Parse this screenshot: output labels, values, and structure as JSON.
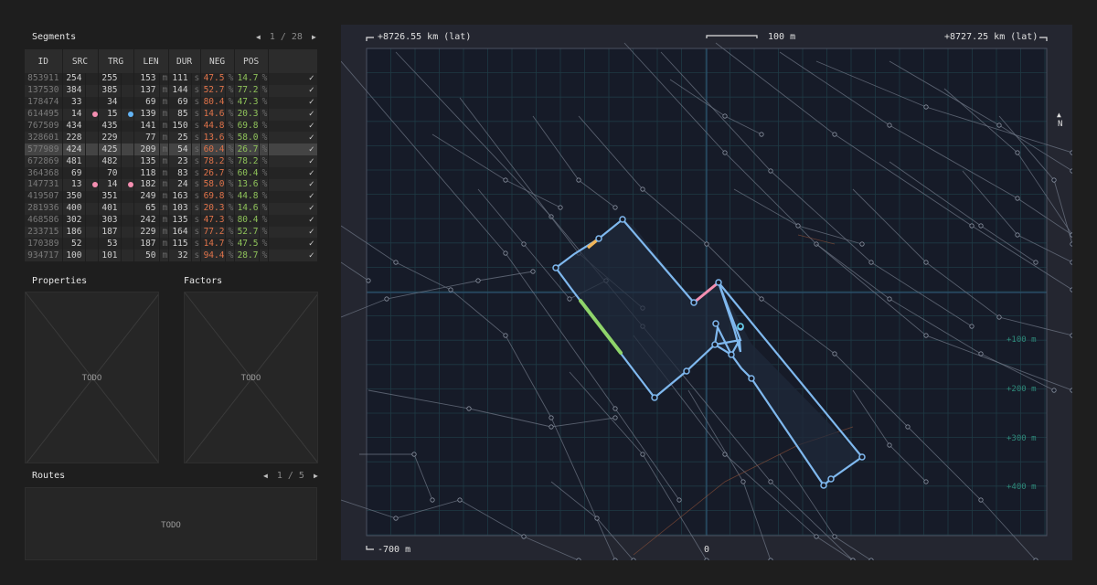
{
  "segments": {
    "title": "Segments",
    "pager": {
      "text": "1 / 28",
      "prev_icon": "◀",
      "next_icon": "▶"
    },
    "columns": [
      "ID",
      "SRC",
      "TRG",
      "LEN",
      "DUR",
      "NEG",
      "POS"
    ],
    "rows": [
      {
        "id": "853911",
        "src": "254",
        "trg": "255",
        "len": "153",
        "dur": "111",
        "neg": "47.5",
        "pos": "14.7",
        "check": "✓"
      },
      {
        "id": "137530",
        "src": "384",
        "trg": "385",
        "len": "137",
        "dur": "144",
        "neg": "52.7",
        "pos": "77.2",
        "check": "✓"
      },
      {
        "id": "178474",
        "src": "33",
        "trg": "34",
        "len": "69",
        "dur": "69",
        "neg": "80.4",
        "pos": "47.3",
        "check": "✓"
      },
      {
        "id": "614495",
        "src": "14",
        "trg": "15",
        "len": "139",
        "dur": "85",
        "neg": "14.6",
        "pos": "20.3",
        "check": "✓",
        "src_dot": "#f48fb1",
        "trg_dot": "#64b5f6"
      },
      {
        "id": "767509",
        "src": "434",
        "trg": "435",
        "len": "141",
        "dur": "150",
        "neg": "44.8",
        "pos": "69.8",
        "check": "✓"
      },
      {
        "id": "328601",
        "src": "228",
        "trg": "229",
        "len": "77",
        "dur": "25",
        "neg": "13.6",
        "pos": "58.0",
        "check": "✓"
      },
      {
        "id": "577989",
        "src": "424",
        "trg": "425",
        "len": "209",
        "dur": "54",
        "neg": "60.4",
        "pos": "26.7",
        "check": "✓",
        "selected": true
      },
      {
        "id": "672869",
        "src": "481",
        "trg": "482",
        "len": "135",
        "dur": "23",
        "neg": "78.2",
        "pos": "78.2",
        "check": "✓"
      },
      {
        "id": "364368",
        "src": "69",
        "trg": "70",
        "len": "118",
        "dur": "83",
        "neg": "26.7",
        "pos": "60.4",
        "check": "✓"
      },
      {
        "id": "147731",
        "src": "13",
        "trg": "14",
        "len": "182",
        "dur": "24",
        "neg": "58.0",
        "pos": "13.6",
        "check": "✓",
        "src_dot": "#f48fb1",
        "trg_dot": "#f48fb1"
      },
      {
        "id": "419507",
        "src": "350",
        "trg": "351",
        "len": "249",
        "dur": "163",
        "neg": "69.8",
        "pos": "44.8",
        "check": "✓"
      },
      {
        "id": "281936",
        "src": "400",
        "trg": "401",
        "len": "65",
        "dur": "103",
        "neg": "20.3",
        "pos": "14.6",
        "check": "✓"
      },
      {
        "id": "468586",
        "src": "302",
        "trg": "303",
        "len": "242",
        "dur": "135",
        "neg": "47.3",
        "pos": "80.4",
        "check": "✓"
      },
      {
        "id": "233715",
        "src": "186",
        "trg": "187",
        "len": "229",
        "dur": "164",
        "neg": "77.2",
        "pos": "52.7",
        "check": "✓"
      },
      {
        "id": "170389",
        "src": "52",
        "trg": "53",
        "len": "187",
        "dur": "115",
        "neg": "14.7",
        "pos": "47.5",
        "check": "✓"
      },
      {
        "id": "934717",
        "src": "100",
        "trg": "101",
        "len": "50",
        "dur": "32",
        "neg": "94.4",
        "pos": "28.7",
        "check": "✓"
      }
    ],
    "units": {
      "len": "m",
      "dur": "s",
      "pct": "%"
    }
  },
  "properties": {
    "title": "Properties",
    "placeholder": "TODO"
  },
  "factors": {
    "title": "Factors",
    "placeholder": "TODO"
  },
  "routes": {
    "title": "Routes",
    "pager": {
      "text": "1 / 5",
      "prev_icon": "◀",
      "next_icon": "▶"
    },
    "placeholder": "TODO"
  },
  "map": {
    "top_left_label": "+8726.55 km (lat)",
    "top_right_label": "+8727.25 km (lat)",
    "scale_label": "100 m",
    "bottom_left_label": "-700 m",
    "bottom_center_label": "0",
    "north_arrow": "▲",
    "north_label": "N",
    "y_axis_labels": [
      "+100 m",
      "+200 m",
      "+300 m",
      "+400 m"
    ],
    "colors": {
      "background": "#161b28",
      "grid": "#1f3a44",
      "roads": "#6d7584",
      "route": "#7fb8ee",
      "highlight_green": "#8fd46a",
      "highlight_pink": "#f48fb1",
      "highlight_orange": "#f0b55a",
      "node_cyan": "#6ad4f0"
    }
  }
}
